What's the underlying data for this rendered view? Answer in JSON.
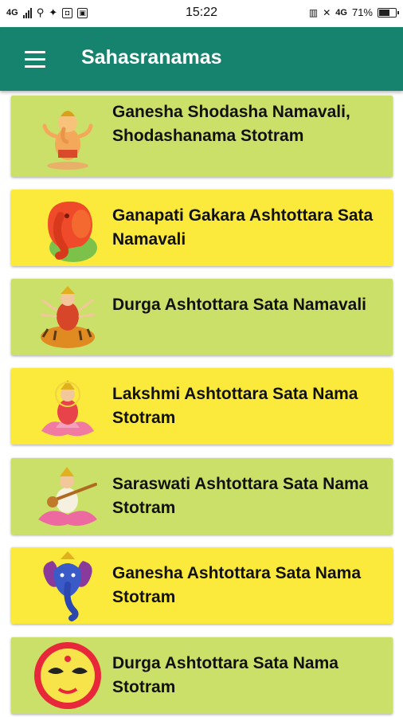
{
  "status_bar": {
    "network": "4G",
    "time": "15:22",
    "network_right": "4G",
    "battery": "71%",
    "battery_level": 0.71
  },
  "app_bar": {
    "title": "Sahasranamas",
    "menu_icon": "hamburger-menu-icon"
  },
  "items": [
    {
      "title": "Ganesha Shodasha Namavali, Shodashanama Stotram",
      "icon": "ganesha-deity-icon",
      "color": "#cbe069"
    },
    {
      "title": "Ganapati Gakara Ashtottara Sata Namavali",
      "icon": "red-ganesha-icon",
      "color": "#fbe93b"
    },
    {
      "title": "Durga Ashtottara Sata Namavali",
      "icon": "durga-on-tiger-icon",
      "color": "#cbe069"
    },
    {
      "title": "Lakshmi Ashtottara Sata Nama Stotram",
      "icon": "lakshmi-on-lotus-icon",
      "color": "#fbe93b"
    },
    {
      "title": "Saraswati Ashtottara Sata Nama Stotram",
      "icon": "saraswati-with-veena-icon",
      "color": "#cbe069"
    },
    {
      "title": "Ganesha Ashtottara Sata Nama Stotram",
      "icon": "blue-ganesha-icon",
      "color": "#fbe93b"
    },
    {
      "title": "Durga Ashtottara Sata Nama Stotram",
      "icon": "durga-face-icon",
      "color": "#cbe069"
    }
  ]
}
